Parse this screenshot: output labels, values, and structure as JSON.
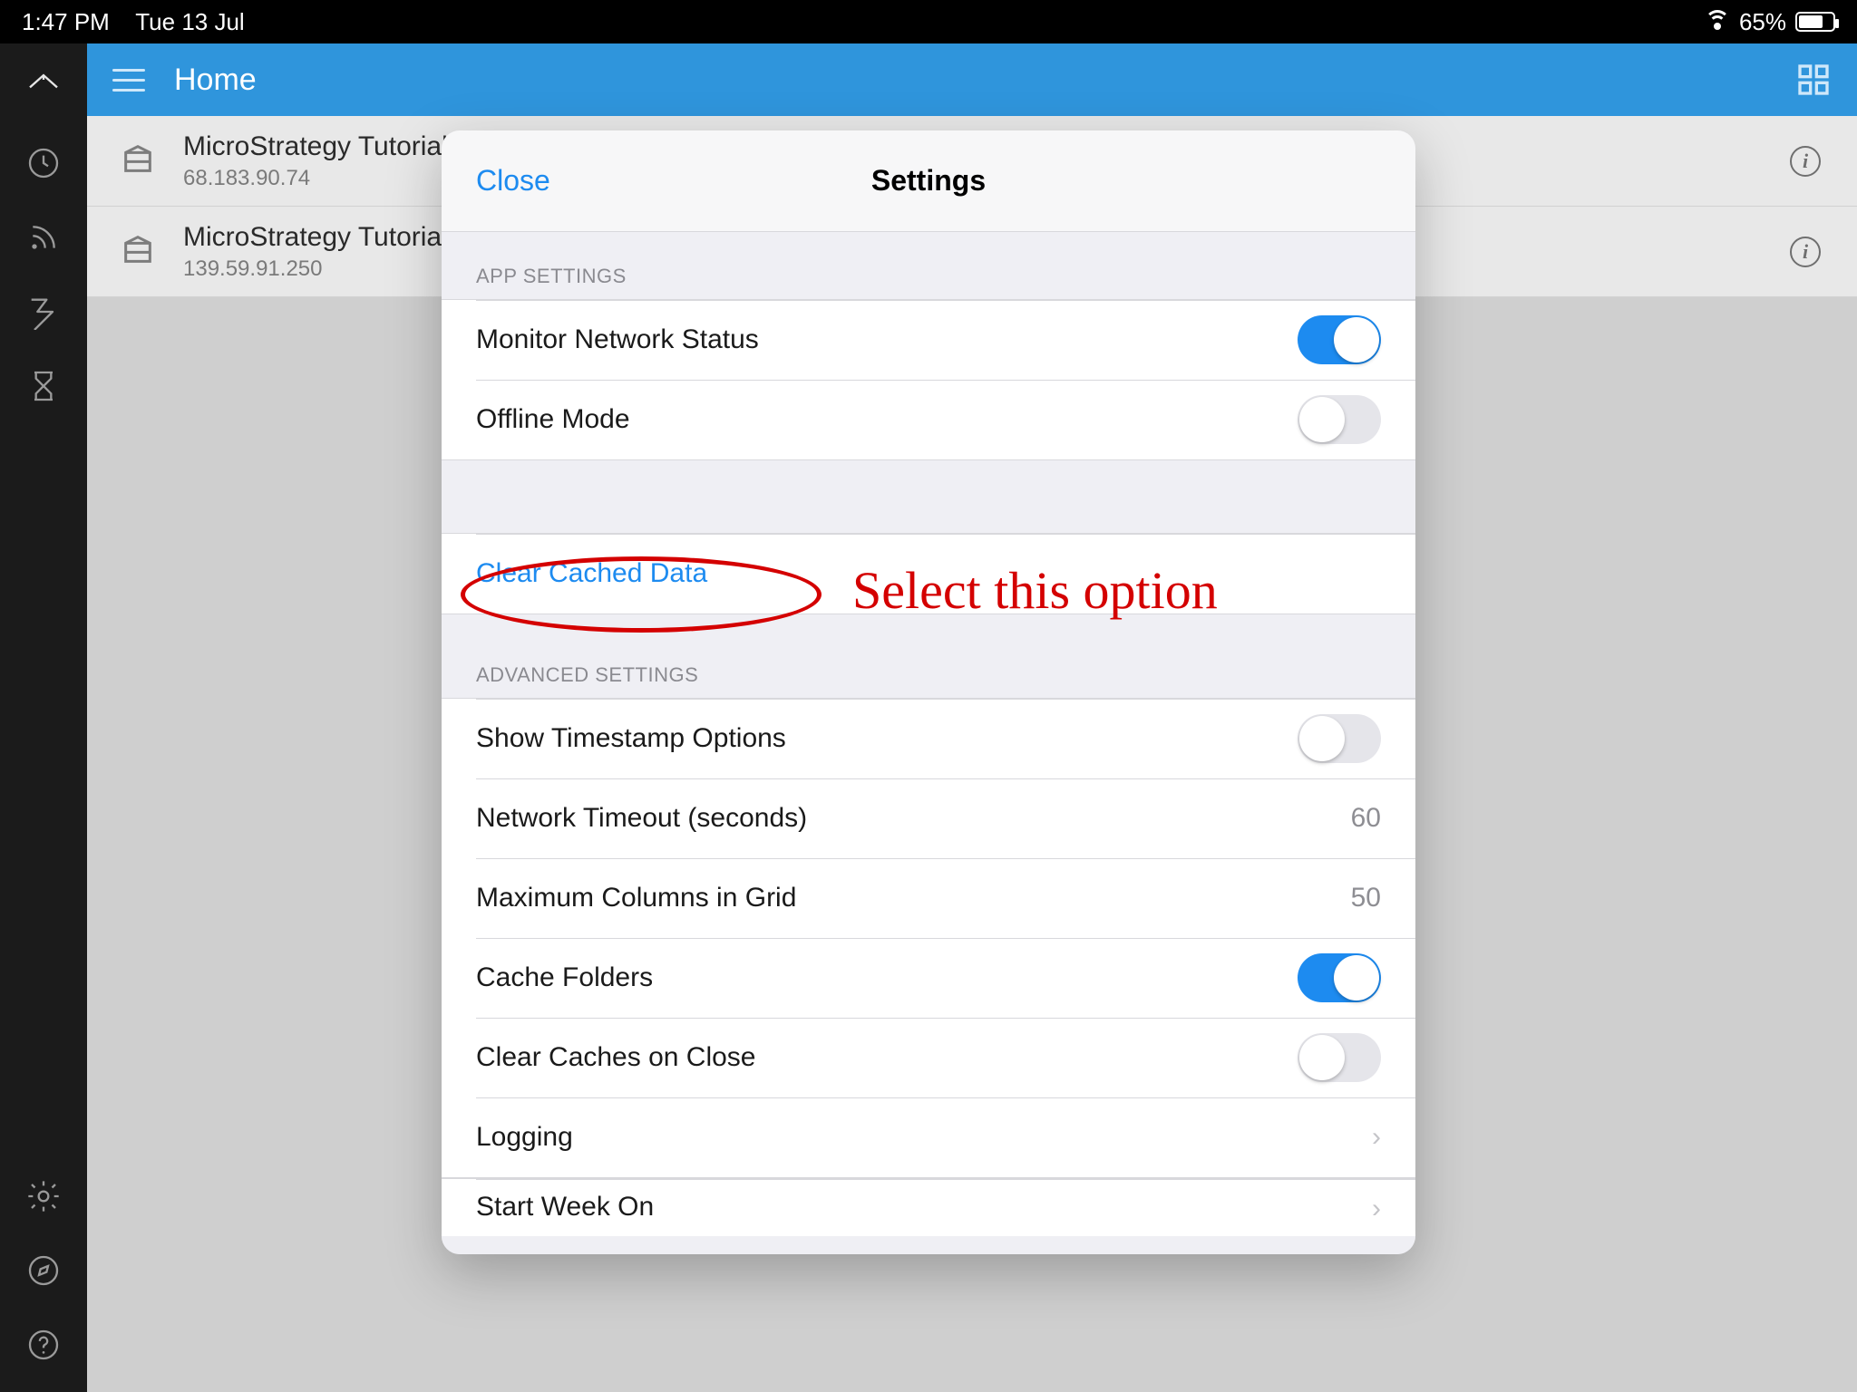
{
  "statusbar": {
    "time": "1:47 PM",
    "date": "Tue 13 Jul",
    "battery_pct": "65%"
  },
  "header": {
    "title": "Home"
  },
  "servers": [
    {
      "title": "MicroStrategy Tutorial",
      "subtitle": "68.183.90.74"
    },
    {
      "title": "MicroStrategy Tutorial",
      "subtitle": "139.59.91.250"
    }
  ],
  "modal": {
    "close_label": "Close",
    "title": "Settings",
    "app_settings_label": "APP SETTINGS",
    "monitor_network": {
      "label": "Monitor Network Status",
      "on": true
    },
    "offline_mode": {
      "label": "Offline Mode",
      "on": false
    },
    "clear_cache_label": "Clear Cached Data",
    "advanced_label": "ADVANCED SETTINGS",
    "show_ts": {
      "label": "Show Timestamp Options",
      "on": false
    },
    "net_timeout": {
      "label": "Network Timeout (seconds)",
      "value": "60"
    },
    "max_cols": {
      "label": "Maximum Columns in Grid",
      "value": "50"
    },
    "cache_folders": {
      "label": "Cache Folders",
      "on": true
    },
    "clear_on_close": {
      "label": "Clear Caches on Close",
      "on": false
    },
    "logging": {
      "label": "Logging"
    },
    "start_week": {
      "label": "Start Week On"
    }
  },
  "annotation": {
    "text": "Select this option"
  }
}
